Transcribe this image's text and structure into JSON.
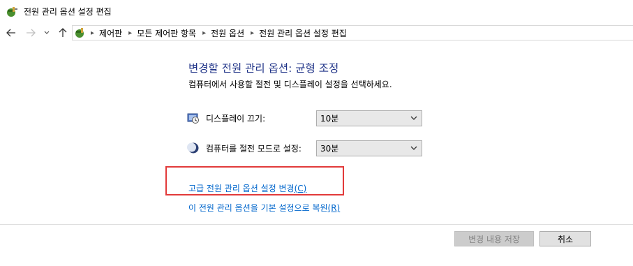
{
  "window": {
    "title": "전원 관리 옵션 설정 편집"
  },
  "nav": {
    "back_icon": "arrow-left",
    "forward_icon": "arrow-right",
    "recent_icon": "chevron-down",
    "up_icon": "arrow-up",
    "breadcrumbs": [
      "제어판",
      "모든 제어판 항목",
      "전원 옵션",
      "전원 관리 옵션 설정 편집"
    ]
  },
  "main": {
    "heading": "변경할 전원 관리 옵션: 균형 조정",
    "subtext": "컴퓨터에서 사용할 절전 및 디스플레이 설정을 선택하세요.",
    "display_off": {
      "label": "디스플레이 끄기:",
      "value": "10분",
      "icon": "monitor-clock-icon"
    },
    "sleep": {
      "label": "컴퓨터를 절전 모드로 설정:",
      "value": "30분",
      "icon": "moon-icon"
    },
    "advanced_link": {
      "text": "고급 전원 관리 옵션 설정 변경",
      "accel": "(C)"
    },
    "restore_link": {
      "text": "이 전원 관리 옵션을 기본 설정으로 복원",
      "accel": "(R)"
    }
  },
  "footer": {
    "save_label": "변경 내용 저장",
    "cancel_label": "취소"
  },
  "colors": {
    "heading": "#1e3287",
    "link": "#0066cc",
    "highlight": "#e23a3a"
  }
}
